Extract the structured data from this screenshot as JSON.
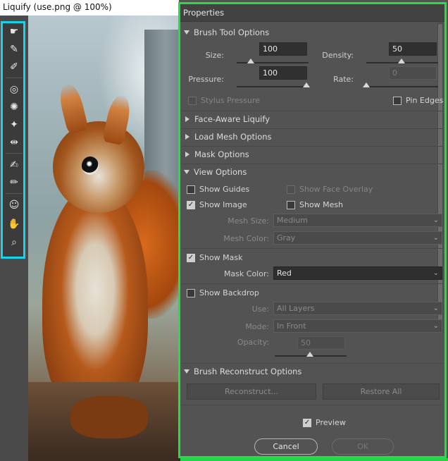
{
  "window": {
    "title": "Liquify (use.png @ 100%)"
  },
  "tools": [
    {
      "name": "forward-warp-tool",
      "glyph": "☛"
    },
    {
      "name": "reconstruct-tool",
      "glyph": "✎"
    },
    {
      "name": "smooth-tool",
      "glyph": "✐"
    },
    {
      "name": "twirl-clockwise-tool",
      "glyph": "◎"
    },
    {
      "name": "pucker-tool",
      "glyph": "✺"
    },
    {
      "name": "bloat-tool",
      "glyph": "✦"
    },
    {
      "name": "push-left-tool",
      "glyph": "⇹"
    },
    {
      "name": "freeze-mask-tool",
      "glyph": "✍"
    },
    {
      "name": "thaw-mask-tool",
      "glyph": "✏"
    },
    {
      "name": "face-tool",
      "glyph": "☺"
    },
    {
      "name": "hand-tool",
      "glyph": "✋"
    },
    {
      "name": "zoom-tool",
      "glyph": "⌕"
    }
  ],
  "panel": {
    "title": "Properties",
    "brush_tool_options": {
      "heading": "Brush Tool Options",
      "size_label": "Size:",
      "size_value": "100",
      "density_label": "Density:",
      "density_value": "50",
      "pressure_label": "Pressure:",
      "pressure_value": "100",
      "rate_label": "Rate:",
      "rate_value": "0",
      "stylus_pressure_label": "Stylus Pressure",
      "pin_edges_label": "Pin Edges"
    },
    "face_aware": {
      "heading": "Face-Aware Liquify"
    },
    "load_mesh": {
      "heading": "Load Mesh Options"
    },
    "mask_options": {
      "heading": "Mask Options"
    },
    "view_options": {
      "heading": "View Options",
      "show_guides_label": "Show Guides",
      "show_face_overlay_label": "Show Face Overlay",
      "show_image_label": "Show Image",
      "show_mesh_label": "Show Mesh",
      "mesh_size_label": "Mesh Size:",
      "mesh_size_value": "Medium",
      "mesh_color_label": "Mesh Color:",
      "mesh_color_value": "Gray",
      "show_mask_label": "Show Mask",
      "mask_color_label": "Mask Color:",
      "mask_color_value": "Red",
      "show_backdrop_label": "Show Backdrop",
      "use_label": "Use:",
      "use_value": "All Layers",
      "mode_label": "Mode:",
      "mode_value": "In Front",
      "opacity_label": "Opacity:",
      "opacity_value": "50"
    },
    "brush_reconstruct": {
      "heading": "Brush Reconstruct Options",
      "reconstruct_label": "Reconstruct...",
      "restore_all_label": "Restore All"
    },
    "preview_label": "Preview",
    "cancel_label": "Cancel",
    "ok_label": "OK"
  },
  "colors": {
    "toolbar_highlight": "#16d3ea",
    "panel_highlight": "#22e044"
  }
}
